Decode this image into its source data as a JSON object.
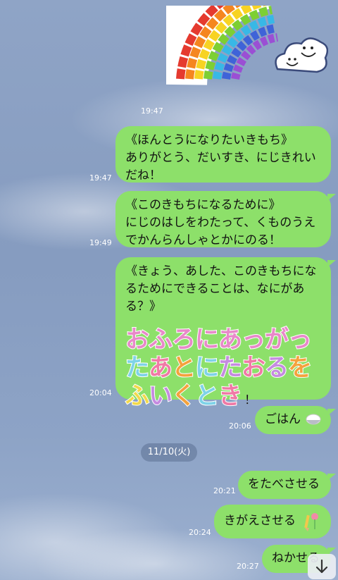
{
  "sticker": {
    "name": "rainbow-smiley-cloud-sticker"
  },
  "timestamp_top": "19:47",
  "messages": [
    {
      "time": "19:47",
      "lines": [
        "《ほんとうになりたいきもち》",
        "ありがとう、だいすき、にじきれい",
        "だね！"
      ]
    },
    {
      "time": "19:49",
      "lines": [
        "《このきもちになるために》",
        "にじのはしをわたって、くものうえ",
        "でかんらんしゃとかにのる！"
      ]
    },
    {
      "time": "20:04",
      "lines": [
        "《きょう、あした、このきもちにな",
        "るためにできることは、なにがあ",
        "る？》"
      ],
      "deco_lines": [
        [
          {
            "ch": "お",
            "color": "#e889c9"
          },
          {
            "ch": "ふ",
            "color": "#e889c9"
          },
          {
            "ch": "ろ",
            "color": "#e889c9"
          },
          {
            "ch": "に",
            "color": "#e889c9"
          },
          {
            "ch": "あ",
            "color": "#e889c9"
          },
          {
            "ch": "っ",
            "color": "#e889c9"
          },
          {
            "ch": "が",
            "color": "#e889c9"
          },
          {
            "ch": "っ",
            "color": "#e889c9"
          }
        ],
        [
          {
            "ch": "た",
            "color": "#7fd3e8"
          },
          {
            "ch": "あ",
            "color": "#f07aa6"
          },
          {
            "ch": "と",
            "color": "#f4a23d"
          },
          {
            "ch": "に",
            "color": "#7fd3e8"
          },
          {
            "ch": "た",
            "color": "#c58be0"
          },
          {
            "ch": "お",
            "color": "#f07aa6"
          },
          {
            "ch": "る",
            "color": "#c58be0"
          },
          {
            "ch": "を",
            "color": "#f4a23d"
          }
        ],
        [
          {
            "ch": "ふ",
            "color": "#f2d94a"
          },
          {
            "ch": "い",
            "color": "#c58be0"
          },
          {
            "ch": "く",
            "color": "#f4a23d"
          },
          {
            "ch": "と",
            "color": "#7fd3e8"
          },
          {
            "ch": "き",
            "color": "#f07aa6"
          }
        ]
      ],
      "deco_suffix": "！"
    },
    {
      "time": "20:06",
      "lines": [
        "ごはん"
      ],
      "icon": "rice-bowl-icon"
    },
    {
      "time": "20:21",
      "lines": [
        "をたべさせる"
      ]
    },
    {
      "time": "20:24",
      "lines": [
        "きがえさせる"
      ],
      "icon": "flower-pencil-icon"
    },
    {
      "time": "20:27",
      "lines": [
        "ねかせる"
      ]
    }
  ],
  "date_separator": "11/10(火)",
  "scroll_button": {
    "icon": "arrow-down-icon"
  },
  "colors": {
    "bubble": "#8de06a",
    "background": "#8aa0c4"
  }
}
